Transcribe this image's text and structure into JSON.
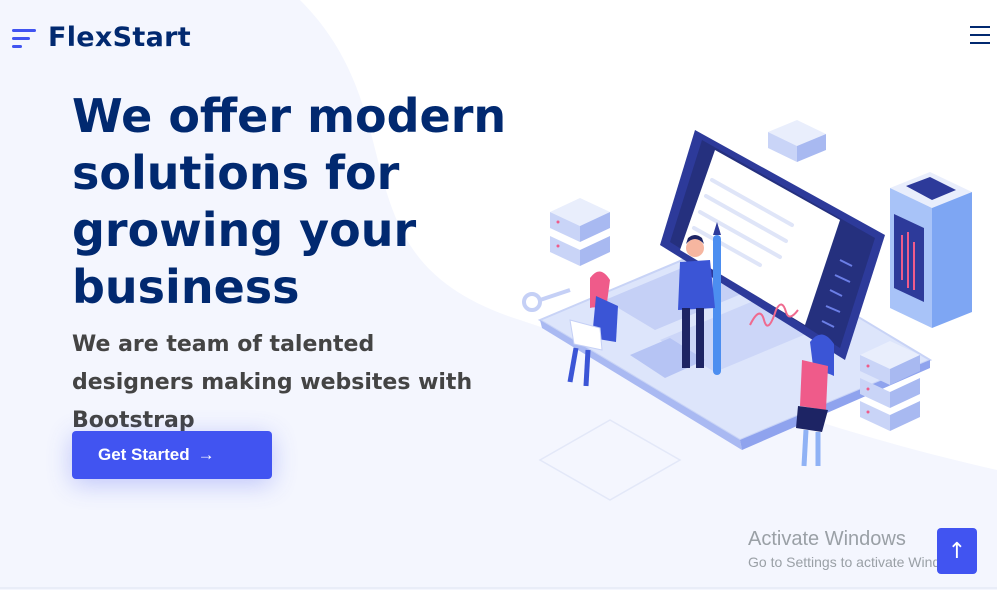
{
  "brand": {
    "name": "FlexStart"
  },
  "nav": {
    "menu_icon": "hamburger-icon"
  },
  "hero": {
    "title": "We offer modern solutions for growing your business",
    "subtitle": "We are team of talented designers making websites with Bootstrap",
    "cta_label": "Get Started",
    "cta_arrow": "→"
  },
  "watermark": {
    "title": "Activate Windows",
    "subtitle": "Go to Settings to activate Windows."
  },
  "back_to_top": {
    "icon": "arrow-up-icon",
    "glyph": "↑"
  },
  "colors": {
    "primary": "#4154f1",
    "heading": "#012970",
    "text": "#444444",
    "background": "#f4f6fe"
  }
}
